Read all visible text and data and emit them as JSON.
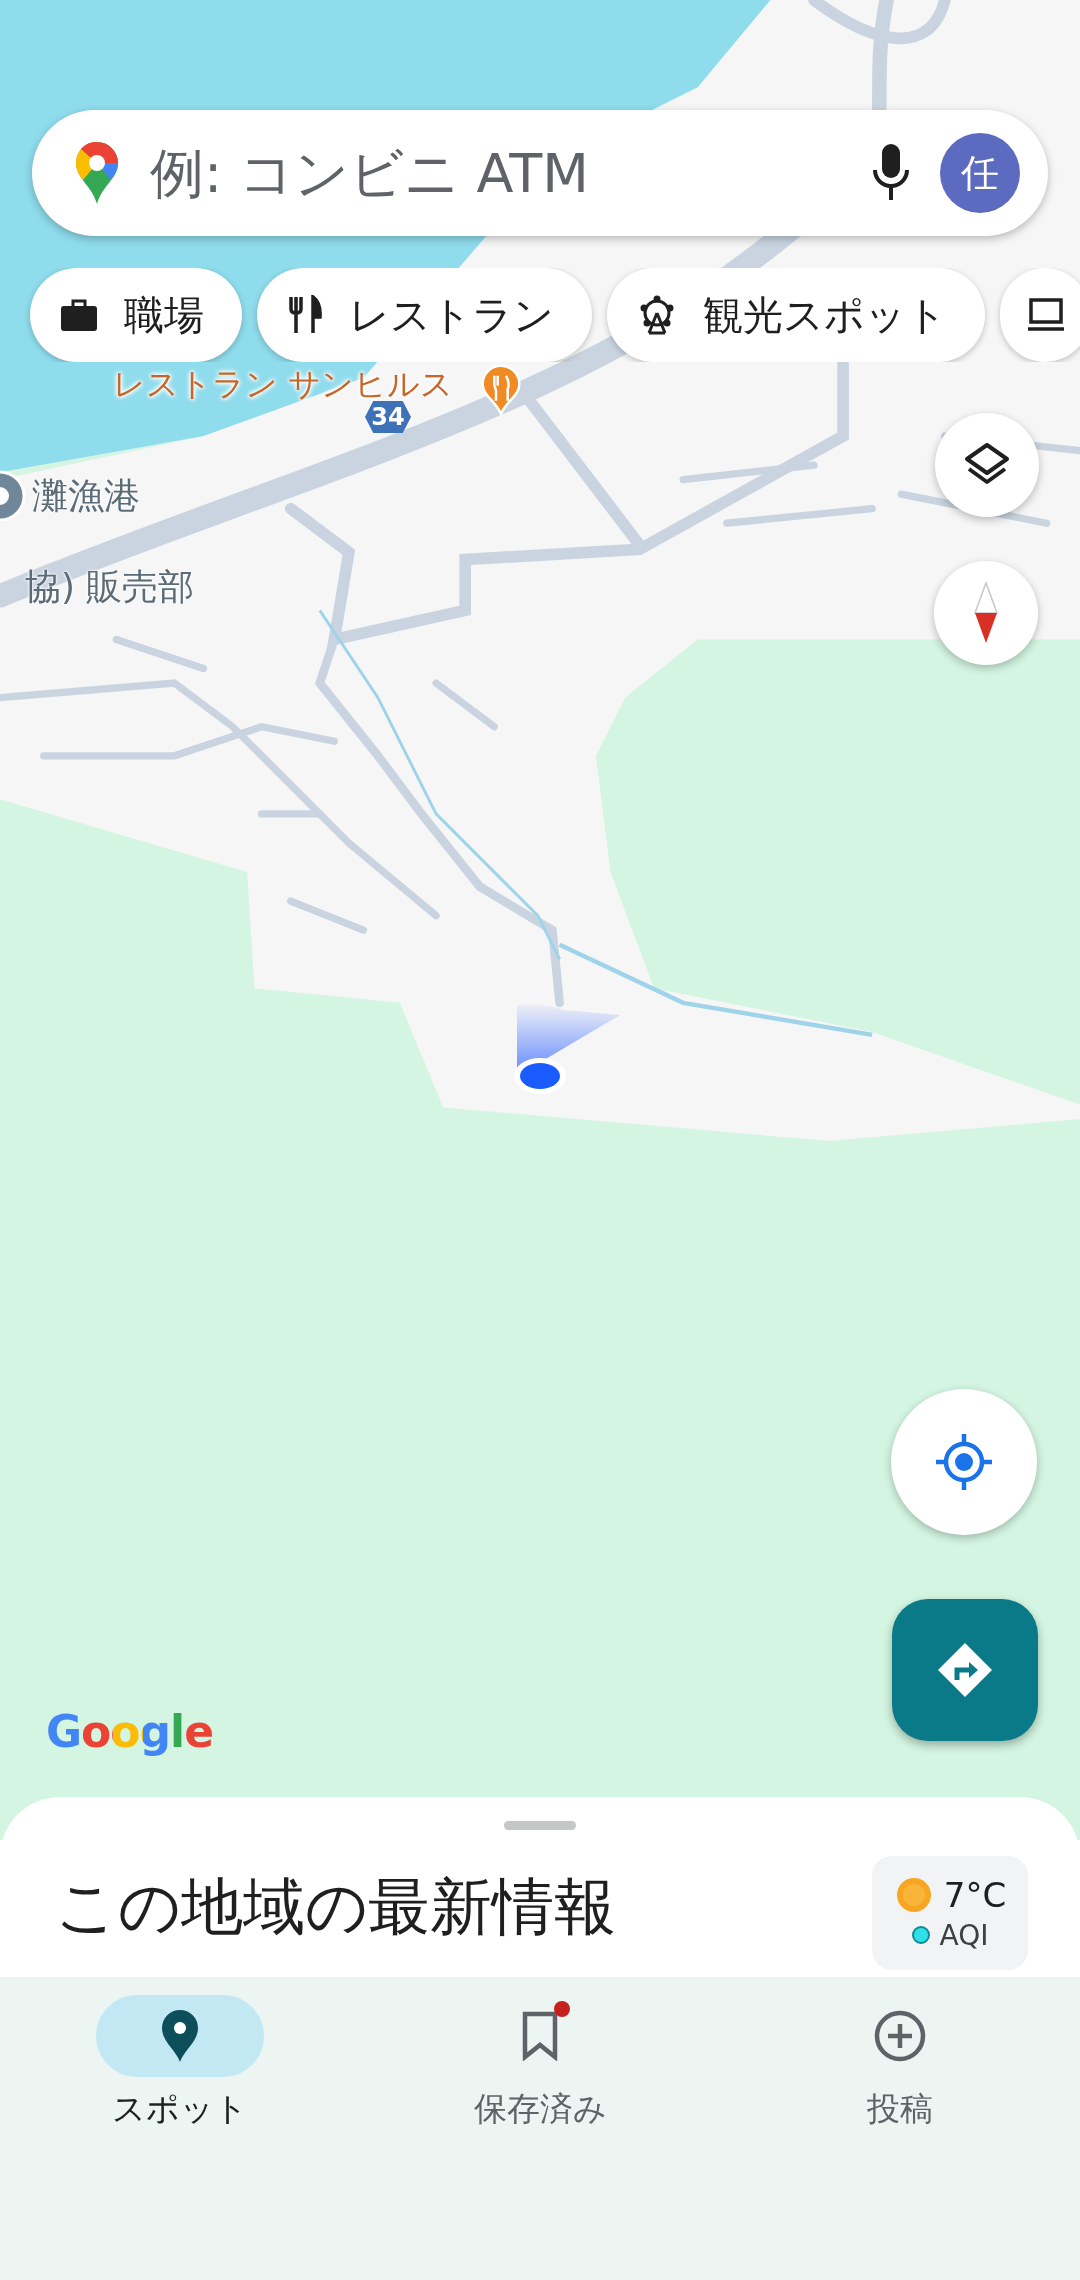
{
  "search": {
    "placeholder": "例: コンビニ ATM",
    "avatar_letter": "任"
  },
  "chips": [
    {
      "label": "職場"
    },
    {
      "label": "レストラン"
    },
    {
      "label": "観光スポット"
    }
  ],
  "map": {
    "labels": [
      {
        "text": "レストラン サンヒルス",
        "kind": "restaurant"
      },
      {
        "text": "34",
        "kind": "route"
      },
      {
        "text": "灘漁港",
        "kind": "harbor"
      },
      {
        "text": "協) 販売部",
        "kind": "place"
      }
    ],
    "attribution": "Google"
  },
  "sheet": {
    "title": "この地域の最新情報",
    "weather": {
      "temperature": "7°C",
      "aqi": "AQI"
    }
  },
  "nav": {
    "items": [
      {
        "label": "スポット",
        "selected": true,
        "notification_dot": false
      },
      {
        "label": "保存済み",
        "selected": false,
        "notification_dot": true
      },
      {
        "label": "投稿",
        "selected": false,
        "notification_dot": false
      }
    ]
  }
}
